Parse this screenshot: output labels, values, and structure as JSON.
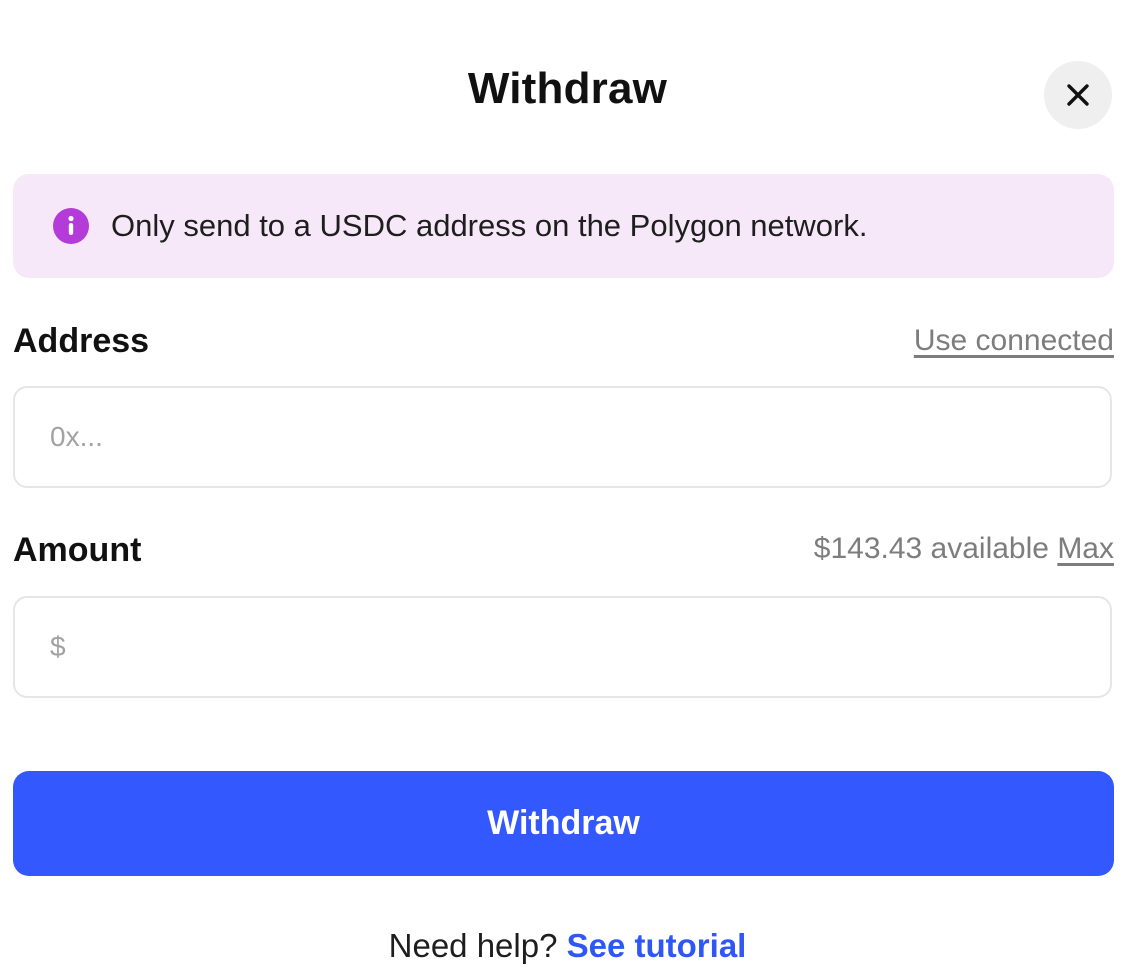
{
  "modal": {
    "title": "Withdraw",
    "close_icon": "close-icon"
  },
  "notice": {
    "icon": "info-icon",
    "icon_color": "#b43ad9",
    "background": "#f6e8f8",
    "text": "Only send to a USDC address on the Polygon network."
  },
  "address": {
    "label": "Address",
    "use_connected": "Use connected",
    "placeholder": "0x...",
    "value": ""
  },
  "amount": {
    "label": "Amount",
    "available": "$143.43 available",
    "max": "Max",
    "placeholder": "$",
    "value": ""
  },
  "submit": {
    "label": "Withdraw",
    "color": "#3358fe"
  },
  "help": {
    "prefix": "Need help?",
    "link": "See tutorial",
    "link_color": "#2f57f5"
  }
}
